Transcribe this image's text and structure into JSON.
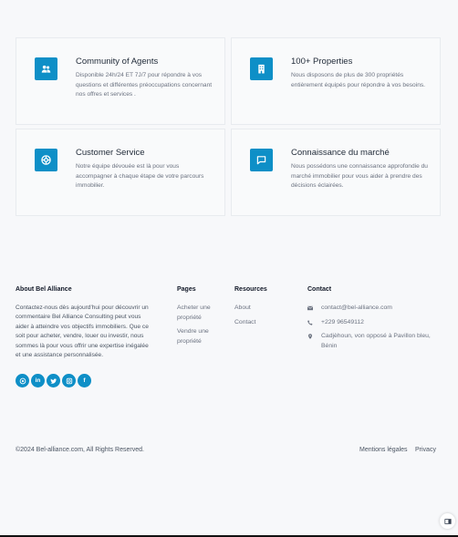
{
  "features": [
    {
      "title": "Community of Agents",
      "desc": "Disponible 24h/24 ET 7J/7 pour répondre à vos questions et différentes préoccupations concernant nos offres et services .",
      "icon": "users-icon"
    },
    {
      "title": "100+ Properties",
      "desc": "Nous disposons de plus de 300 propriétés entièrement équipés pour répondre à vos besoins.",
      "icon": "building-icon"
    },
    {
      "title": "Customer Service",
      "desc": "Notre équipe dévouée est là pour vous accompagner à chaque étape de votre parcours immobilier.",
      "icon": "lifebuoy-icon"
    },
    {
      "title": "Connaissance du marché",
      "desc": "Nous possédons une connaissance approfondie du marché immobilier pour vous aider à prendre des décisions éclairées.",
      "icon": "chat-icon"
    }
  ],
  "footer": {
    "about": {
      "heading": "About Bel Alliance",
      "text": "Contactez-nous dès aujourd'hui pour découvrir un commentaire Bel Alliance Consulting peut vous aider à atteindre vos objectifs immobiliers. Que ce soit pour acheter, vendre, louer ou investir, nous sommes là pour vous offrir une expertise inégalée et une assistance personnalisée."
    },
    "pages": {
      "heading": "Pages",
      "links": [
        "Acheter une propriété",
        "Vendre une propriété"
      ]
    },
    "resources": {
      "heading": "Resources",
      "links": [
        "About",
        "Contact"
      ]
    },
    "contact": {
      "heading": "Contact",
      "email": "contact@bel-alliance.com",
      "phone": "+229 96549112",
      "address": "Cadjèhoun, von opposé à Pavillon bleu, Bénin"
    },
    "copyright": "©2024 Bel-alliance.com, All Rights Reserved.",
    "legal_links": [
      "Mentions légales",
      "Privacy"
    ]
  },
  "colors": {
    "accent": "#0e8fc7"
  }
}
